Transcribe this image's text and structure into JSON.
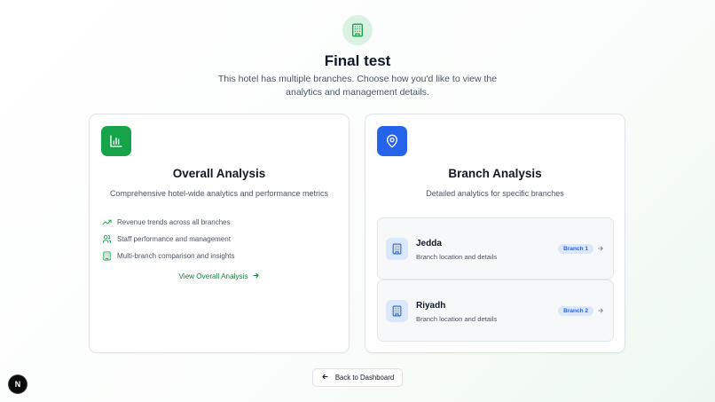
{
  "header": {
    "icon": "building-icon",
    "title": "Final test",
    "subtitle": "This hotel has multiple branches. Choose how you'd like to view the analytics and management details."
  },
  "overall": {
    "icon": "bar-chart-icon",
    "title": "Overall Analysis",
    "description": "Comprehensive hotel-wide analytics and performance metrics",
    "features": [
      {
        "icon": "trending-up-icon",
        "label": "Revenue trends across all branches"
      },
      {
        "icon": "users-icon",
        "label": "Staff performance and management"
      },
      {
        "icon": "building-icon",
        "label": "Multi-branch comparison and insights"
      }
    ],
    "link_label": "View Overall Analysis"
  },
  "branch_analysis": {
    "icon": "map-pin-icon",
    "title": "Branch Analysis",
    "description": "Detailed analytics for specific branches",
    "branches": [
      {
        "name": "Jedda",
        "description": "Branch location and details",
        "badge": "Branch 1"
      },
      {
        "name": "Riyadh",
        "description": "Branch location and details",
        "badge": "Branch 2"
      }
    ]
  },
  "footer": {
    "back_label": "Back to Dashboard",
    "badge_letter": "N"
  },
  "colors": {
    "green": "#16a34a",
    "blue": "#2563eb"
  }
}
